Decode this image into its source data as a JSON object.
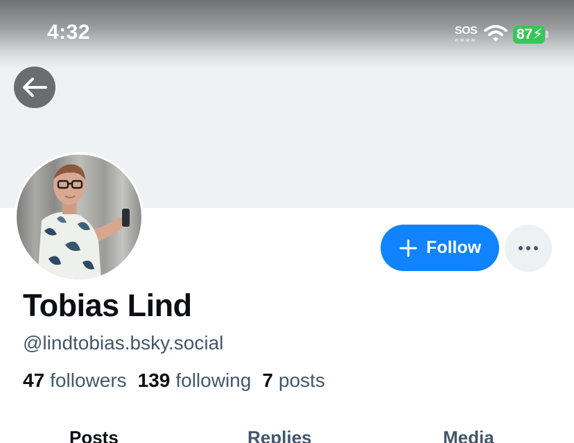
{
  "status_bar": {
    "time": "4:32",
    "sos": "SOS",
    "battery": "87",
    "battery_color": "#35c759"
  },
  "header": {
    "back_icon": "arrow-left-icon"
  },
  "profile": {
    "display_name": "Tobias Lind",
    "handle": "@lindtobias.bsky.social",
    "avatar": "profile-photo"
  },
  "actions": {
    "follow_label": "Follow",
    "follow_color": "#1083fe",
    "more_icon": "ellipsis-icon"
  },
  "stats": {
    "followers_count": "47",
    "followers_label": "followers",
    "following_count": "139",
    "following_label": "following",
    "posts_count": "7",
    "posts_label": "posts"
  },
  "tabs": [
    {
      "label": "Posts",
      "active": true
    },
    {
      "label": "Replies",
      "active": false
    },
    {
      "label": "Media",
      "active": false
    }
  ]
}
